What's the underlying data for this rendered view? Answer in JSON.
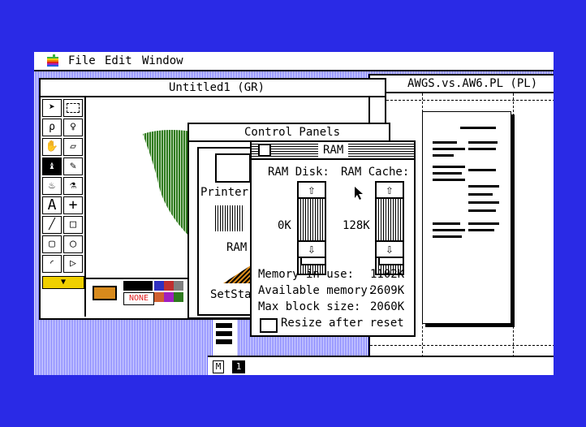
{
  "menubar": {
    "items": [
      "File",
      "Edit",
      "Window"
    ]
  },
  "windows": {
    "paint": {
      "title": "Untitled1 (GR)",
      "pattern_label": "NONE"
    },
    "page": {
      "title": "AWGS.vs.AW6.PL (PL)",
      "page_letter": "M",
      "page_number": "1"
    },
    "control_panels": {
      "title": "Control Panels",
      "items": [
        "Printer P",
        "RAM",
        "SetSta"
      ]
    },
    "ram": {
      "title": "RAM",
      "ram_disk_label": "RAM Disk:",
      "ram_cache_label": "RAM Cache:",
      "ram_disk_value": "0K",
      "ram_cache_value": "128K",
      "stats": [
        {
          "label": "Memory in use:",
          "value": "1102K"
        },
        {
          "label": "Available memory:",
          "value": "2609K"
        },
        {
          "label": "Max block size:",
          "value": "2060K"
        }
      ],
      "resize_label": "Resize after reset",
      "resize_checked": false
    }
  },
  "icons": [
    "apple-icon",
    "arrow-tool-icon",
    "marquee-tool-icon",
    "lasso-tool-icon",
    "lasso-rect-tool-icon",
    "hand-tool-icon",
    "eraser-tool-icon",
    "brush-tool-icon",
    "pencil-tool-icon",
    "bucket-tool-icon",
    "spray-tool-icon",
    "text-tool-icon",
    "crosshair-tool-icon",
    "line-tool-icon",
    "rect-tool-icon",
    "round-rect-tool-icon",
    "oval-tool-icon",
    "arc-tool-icon",
    "polygon-tool-icon",
    "up-arrow-icon",
    "down-arrow-icon"
  ],
  "colors": {
    "background": "#2a2ae6",
    "desktop_stripe": "#5a5aff",
    "green": "#2f7a1f",
    "orange": "#d88a1c"
  }
}
